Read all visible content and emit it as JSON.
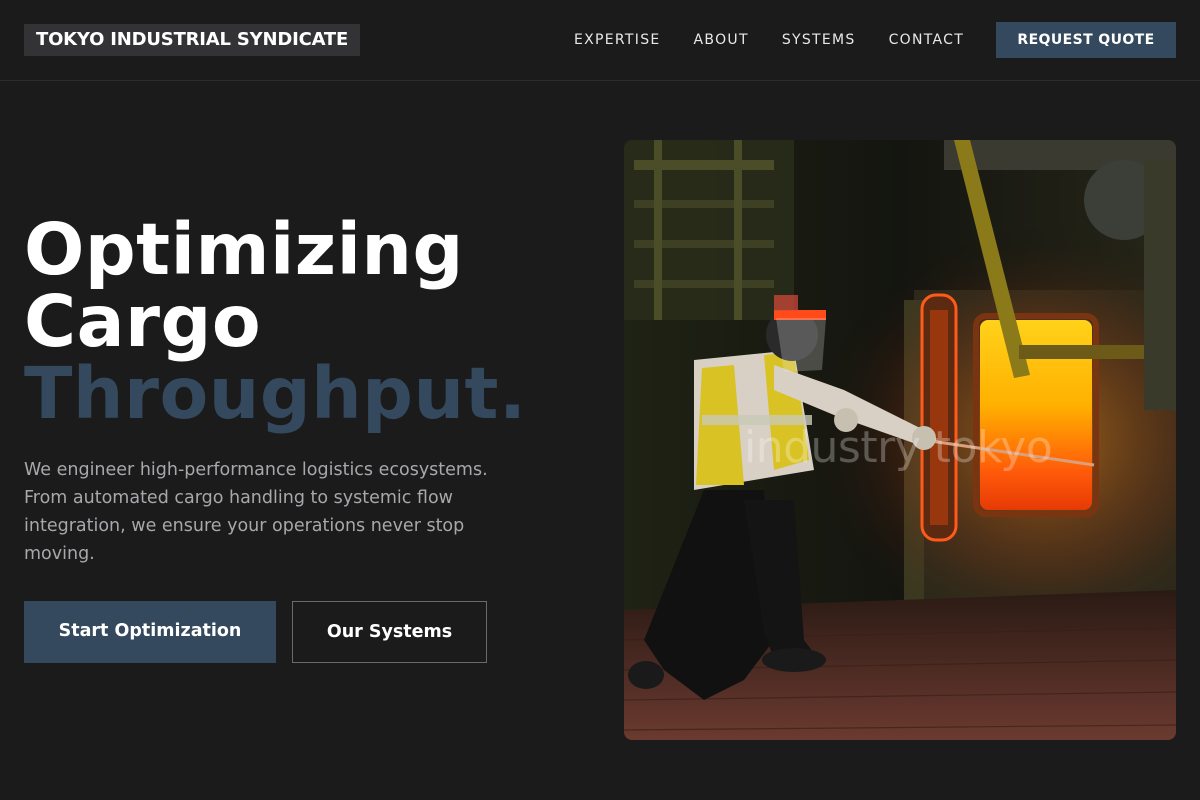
{
  "brand": {
    "name": "TOKYO INDUSTRIAL SYNDICATE"
  },
  "nav": {
    "items": [
      {
        "label": "EXPERTISE"
      },
      {
        "label": "ABOUT"
      },
      {
        "label": "SYSTEMS"
      },
      {
        "label": "CONTACT"
      }
    ],
    "cta_label": "REQUEST QUOTE"
  },
  "hero": {
    "headline_line1": "Optimizing",
    "headline_line2": "Cargo",
    "headline_accent": "Throughput.",
    "description": "We engineer high-performance logistics ecosystems. From automated cargo handling to systemic flow integration, we ensure your operations never stop moving.",
    "primary_button": "Start Optimization",
    "secondary_button": "Our Systems",
    "image_watermark": "industry tokyo"
  },
  "colors": {
    "background": "#1b1b1c",
    "accent": "#34495e",
    "body_text": "#a8a8ac"
  }
}
